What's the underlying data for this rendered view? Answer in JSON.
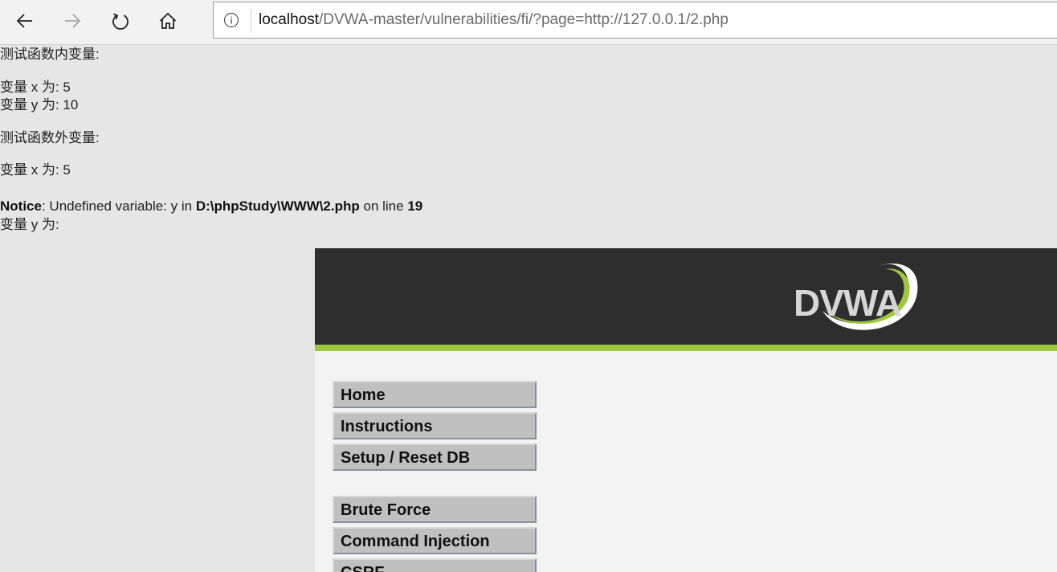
{
  "browser": {
    "address_bar": {
      "host": "localhost",
      "path": "/DVWA-master/vulnerabilities/fi/?page=http://127.0.0.1/2.php"
    }
  },
  "php_output": {
    "inner_heading": "测试函数内变量:",
    "inner_x": "变量 x 为: 5",
    "inner_y": "变量 y 为: 10",
    "outer_heading": "测试函数外变量:",
    "outer_x": "变量 x 为: 5",
    "notice": {
      "label": "Notice",
      "message": ": Undefined variable: y in ",
      "file": "D:\\phpStudy\\WWW\\2.php",
      "on_line": " on line ",
      "line": "19"
    },
    "outer_y": "变量 y 为:"
  },
  "dvwa": {
    "logo_text": "DVWA",
    "menu": {
      "home": "Home",
      "instructions": "Instructions",
      "setup": "Setup / Reset DB",
      "brute_force": "Brute Force",
      "command_injection": "Command Injection",
      "csrf": "CSRF"
    },
    "colors": {
      "header": "#2e2e2e",
      "accent": "#9dc93c",
      "menu_bg": "#c0c0c0"
    }
  }
}
